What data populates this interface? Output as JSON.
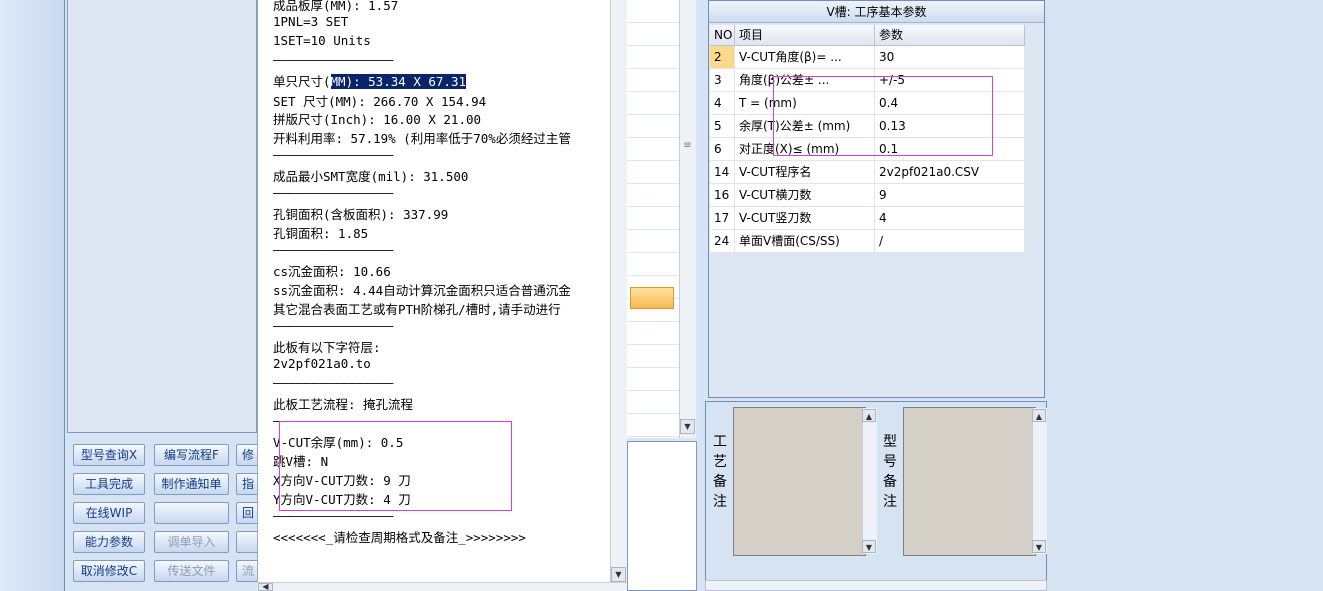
{
  "left": {
    "buttons": [
      {
        "label": "型号查询X",
        "disabled": false
      },
      {
        "label": "编写流程F",
        "disabled": false
      },
      {
        "label": "修",
        "disabled": false
      },
      {
        "label": "工具完成",
        "disabled": false
      },
      {
        "label": "制作通知单",
        "disabled": false
      },
      {
        "label": "指",
        "disabled": false
      },
      {
        "label": "在线WIP",
        "disabled": false
      },
      {
        "label": "",
        "disabled": false
      },
      {
        "label": "回",
        "disabled": false
      },
      {
        "label": "能力参数",
        "disabled": false
      },
      {
        "label": "调单导入",
        "disabled": true
      },
      {
        "label": "",
        "disabled": false
      },
      {
        "label": "取消修改C",
        "disabled": false
      },
      {
        "label": "传送文件",
        "disabled": true
      },
      {
        "label": "流",
        "disabled": true
      }
    ]
  },
  "text": {
    "line01": "成品板厚(MM): 1.57",
    "line02": "1PNL=3 SET",
    "line03": "1SET=10 Units",
    "sep": "————————————————",
    "line04_a": "单只尺寸(",
    "line04_sel": "MM): 53.34 X 67.31",
    "line05": "SET 尺寸(MM): 266.70 X 154.94",
    "line06": "拼版尺寸(Inch): 16.00 X 21.00",
    "line07": "开料利用率: 57.19% (利用率低于70%必须经过主管",
    "line08": "成品最小SMT宽度(mil): 31.500",
    "line09": "孔铜面积(含板面积): 337.99",
    "line10": "孔铜面积: 1.85",
    "line11": "cs沉金面积: 10.66",
    "line12": "ss沉金面积: 4.44自动计算沉金面积只适合普通沉金",
    "line13": "其它混合表面工艺或有PTH阶梯孔/槽时,请手动进行",
    "line14": "此板有以下字符层:",
    "line15": "2v2pf021a0.to",
    "line16": "此板工艺流程: 掩孔流程",
    "line17": "V-CUT余厚(mm): 0.5",
    "line18": "跳V槽: N",
    "line19": "X方向V-CUT刀数: 9 刀",
    "line20": "Y方向V-CUT刀数: 4 刀",
    "line21": "<<<<<<<_请检查周期格式及备注_>>>>>>>>"
  },
  "table": {
    "title": "V槽: 工序基本参数",
    "headers": {
      "no": "NO",
      "item": "项目",
      "param": "参数"
    },
    "rows": [
      {
        "no": "2",
        "item": "V-CUT角度(β)=  ...",
        "param": "30",
        "selected": true
      },
      {
        "no": "3",
        "item": "角度(β)公差±  ...",
        "param": "+/-5",
        "selected": false
      },
      {
        "no": "4",
        "item": "T =  (mm)",
        "param": "0.4",
        "selected": false
      },
      {
        "no": "5",
        "item": "余厚(T)公差±  (mm)",
        "param": "0.13",
        "selected": false
      },
      {
        "no": "6",
        "item": "对正度(X)≤ (mm)",
        "param": "0.1",
        "selected": false
      },
      {
        "no": "14",
        "item": "V-CUT程序名",
        "param": "2v2pf021a0.CSV",
        "selected": false
      },
      {
        "no": "16",
        "item": "V-CUT横刀数",
        "param": "9",
        "selected": false
      },
      {
        "no": "17",
        "item": "V-CUT竖刀数",
        "param": "4",
        "selected": false
      },
      {
        "no": "24",
        "item": "单面V槽面(CS/SS)",
        "param": "/",
        "selected": false
      }
    ]
  },
  "notes": {
    "process_label": [
      "工",
      "艺",
      "备",
      "注"
    ],
    "model_label": [
      "型",
      "号",
      "备",
      "注"
    ]
  },
  "colors": {
    "selection": "#0a246a",
    "annotation": "#d43fd4",
    "highlight": "#ffd98a"
  }
}
